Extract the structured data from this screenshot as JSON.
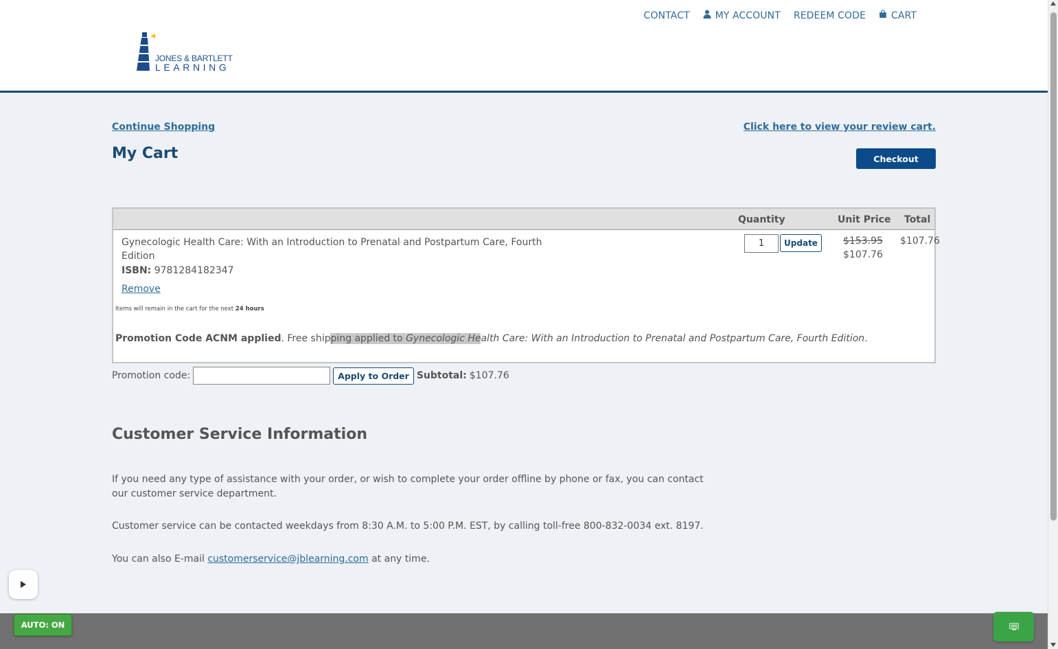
{
  "header": {
    "nav": [
      {
        "label": "CONTACT",
        "icon": ""
      },
      {
        "label": "MY ACCOUNT",
        "icon": "user-icon"
      },
      {
        "label": "REDEEM CODE",
        "icon": ""
      },
      {
        "label": "CART",
        "icon": "shopping-bag-icon"
      }
    ],
    "logo": {
      "line1": "JONES & BARTLETT",
      "line2": "LEARNING"
    }
  },
  "links": {
    "continue_shopping": "Continue Shopping",
    "review_cart": "Click here to view your review cart."
  },
  "page_title": "My Cart",
  "checkout_label": "Checkout",
  "cart": {
    "headers": {
      "quantity": "Quantity",
      "unit_price": "Unit Price",
      "total": "Total"
    },
    "item": {
      "name": "Gynecologic Health Care: With an Introduction to Prenatal and Postpartum Care, Fourth Edition",
      "isbn_label": "ISBN:",
      "isbn": "9781284182347",
      "remove": "Remove",
      "quantity": "1",
      "update_label": "Update",
      "original_price": "$153.95",
      "unit_price": "$107.76",
      "total": "$107.76"
    },
    "note_prefix": "Items will remain in the cart for the next",
    "note_duration": "24 hours",
    "promo_applied": {
      "bold": "Promotion Code ACNM applied",
      "text_before": ". Free ship",
      "highlight_plain": "ping applied to ",
      "highlight_italic": "Gynecologic He",
      "italic_after": "alth Care: With an Introduction to Prenatal and Postpartum Care, Fourth Edition",
      "end": "."
    }
  },
  "promo": {
    "label": "Promotion code:",
    "value": "",
    "apply_label": "Apply to Order",
    "subtotal_label": "Subtotal:",
    "subtotal_value": "$107.76"
  },
  "customer_service": {
    "title": "Customer Service Information",
    "p1": "If you need any type of assistance with your order, or wish to complete your order offline by phone or fax, you can contact our customer service department.",
    "p2": "Customer service can be contacted weekdays from 8:30 A.M. to 5:00 P.M. EST, by calling toll-free 800-832-0034 ext. 8197.",
    "p3_before": "You can also E-mail ",
    "email": "customerservice@jblearning.com",
    "p3_after": " at any time."
  },
  "overlay": {
    "auto_label": "AUTO: ON"
  },
  "colors": {
    "brand_blue": "#1b4b74",
    "link_blue": "#2f6b9a",
    "button_blue": "#0c4a8a",
    "green": "#45a845"
  }
}
